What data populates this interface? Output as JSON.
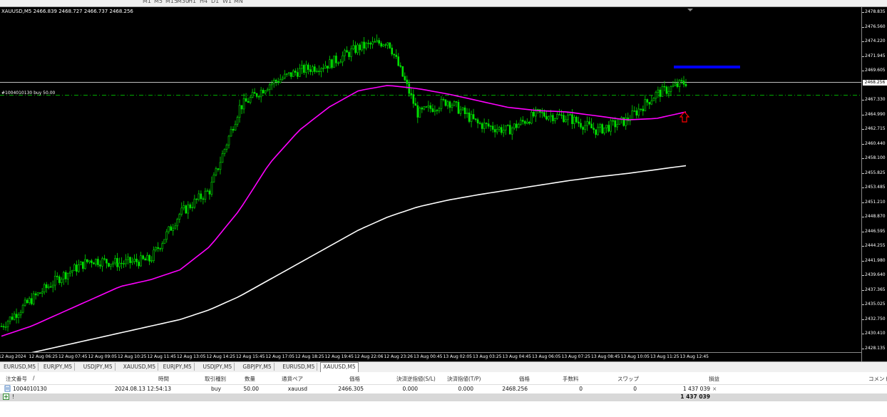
{
  "window": {
    "symbol_title": "XAUUSD,M5  2466.839 2468.727 2466.737 2468.256",
    "order_line_label": "#1004010130 buy 50.00",
    "current_price": "2468.256"
  },
  "toolbar": {
    "items": [
      "M1",
      "M5",
      "M15",
      "M30",
      "H1",
      "H4",
      "D1",
      "W1",
      "MN"
    ]
  },
  "price_axis": {
    "labels": [
      "2478.835",
      "2476.560",
      "2474.220",
      "2471.945",
      "2469.605",
      "2468.256",
      "2467.330",
      "2464.990",
      "2462.715",
      "2460.440",
      "2458.100",
      "2455.825",
      "2453.485",
      "2451.210",
      "2448.870",
      "2446.595",
      "2444.255",
      "2441.980",
      "2439.640",
      "2437.365",
      "2435.025",
      "2432.750",
      "2430.410",
      "2428.135"
    ]
  },
  "time_axis": {
    "labels": [
      "12 Aug 2024",
      "12 Aug 06:25",
      "12 Aug 07:45",
      "12 Aug 09:05",
      "12 Aug 10:25",
      "12 Aug 11:45",
      "12 Aug 13:05",
      "12 Aug 14:25",
      "12 Aug 15:45",
      "12 Aug 17:05",
      "12 Aug 18:25",
      "12 Aug 19:45",
      "12 Aug 22:06",
      "12 Aug 23:26",
      "13 Aug 00:45",
      "13 Aug 02:05",
      "13 Aug 03:25",
      "13 Aug 04:45",
      "13 Aug 06:05",
      "13 Aug 07:25",
      "13 Aug 08:45",
      "13 Aug 10:05",
      "13 Aug 11:25",
      "13 Aug 12:45"
    ]
  },
  "chart_tabs": [
    {
      "label": "EURUSD,M5",
      "active": false
    },
    {
      "label": "EURJPY,M5",
      "active": false
    },
    {
      "label": "USDJPY,M5",
      "active": false
    },
    {
      "label": "XAUUSD,M5",
      "active": false
    },
    {
      "label": "EURJPY,M5",
      "active": false
    },
    {
      "label": "USDJPY,M5",
      "active": false
    },
    {
      "label": "GBPJPY,M5",
      "active": false
    },
    {
      "label": "EURUSD,M5",
      "active": false
    },
    {
      "label": "XAUUSD,M5",
      "active": true
    }
  ],
  "trade_table": {
    "headers": [
      "注文番号",
      "/",
      "時間",
      "取引種別",
      "数量",
      "通貨ペア",
      "価格",
      "決済逆指値(S/L)",
      "決済指値(T/P)",
      "価格",
      "手数料",
      "スワップ",
      "損益",
      "コメント"
    ],
    "row": {
      "order": "1004010130",
      "time": "2024.08.13 12:54:13",
      "type": "buy",
      "volume": "50.00",
      "symbol": "xauusd",
      "open_price": "2466.305",
      "sl": "0.000",
      "tp": "0.000",
      "price": "2468.256",
      "commission": "0",
      "swap": "0",
      "profit": "1 437 039",
      "close_glyph": "×"
    },
    "balance_label": "!",
    "balance_profit": "1 437 039"
  },
  "chart_data": {
    "type": "line",
    "ylim": [
      2428.135,
      2478.835
    ],
    "x": [
      "12 Aug 2024",
      "12 Aug 06:25",
      "12 Aug 07:45",
      "12 Aug 09:05",
      "12 Aug 10:25",
      "12 Aug 11:45",
      "12 Aug 13:05",
      "12 Aug 14:25",
      "12 Aug 15:45",
      "12 Aug 17:05",
      "12 Aug 18:25",
      "12 Aug 19:45",
      "12 Aug 22:06",
      "12 Aug 23:26",
      "13 Aug 00:45",
      "13 Aug 02:05",
      "13 Aug 03:25",
      "13 Aug 04:45",
      "13 Aug 06:05",
      "13 Aug 07:25",
      "13 Aug 08:45",
      "13 Aug 10:05",
      "13 Aug 11:25",
      "13 Aug 12:45"
    ],
    "series": [
      {
        "color": "#00e000",
        "values": [
          2431.5,
          2435.5,
          2439.0,
          2441.5,
          2441.0,
          2441.5,
          2448.5,
          2452.0,
          2464.5,
          2468.0,
          2470.0,
          2471.0,
          2473.5,
          2474.5,
          2463.5,
          2465.5,
          2462.0,
          2461.0,
          2463.5,
          2463.0,
          2461.0,
          2462.5,
          2466.5,
          2468.3
        ]
      },
      {
        "color": "#ff00ff",
        "values": [
          2430.0,
          2431.5,
          2433.5,
          2435.5,
          2437.5,
          2438.5,
          2440.0,
          2443.5,
          2449.0,
          2456.0,
          2461.0,
          2464.5,
          2467.0,
          2467.8,
          2467.3,
          2466.5,
          2465.5,
          2464.5,
          2464.0,
          2463.8,
          2463.2,
          2462.6,
          2462.8,
          2463.8
        ]
      },
      {
        "color": "#ffffff",
        "values": [
          2426.5,
          2427.5,
          2428.5,
          2429.5,
          2430.5,
          2431.5,
          2432.5,
          2434.0,
          2436.0,
          2438.5,
          2441.0,
          2443.5,
          2446.0,
          2448.0,
          2449.5,
          2450.5,
          2451.3,
          2452.0,
          2452.7,
          2453.4,
          2454.0,
          2454.5,
          2455.1,
          2455.7
        ]
      }
    ],
    "hlines": [
      {
        "color": "#ffffff",
        "value": 2468.256
      },
      {
        "color": "#00cc00",
        "value": 2466.305
      }
    ],
    "grid": false
  },
  "colors": {
    "background": "#000000",
    "candle": "#00e000",
    "ma_fast": "#ff00ff",
    "ma_slow": "#ffffff",
    "marker_blue": "#0000ff",
    "arrow_red": "#ff0000"
  }
}
